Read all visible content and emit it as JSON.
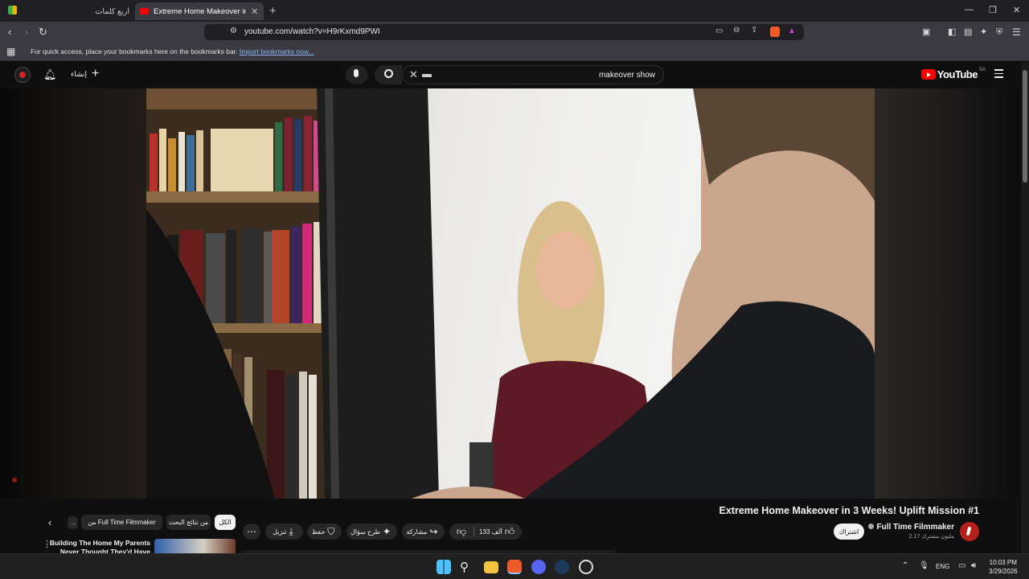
{
  "browser": {
    "tabs": [
      {
        "title": "أربع كلمات",
        "active": false
      },
      {
        "title": "Extreme Home Makeover in 3 Weeks! Uplift Mission #1",
        "active": true
      }
    ],
    "url": "youtube.com/watch?v=H9rKxmd9PWI",
    "bookmarks_bar": {
      "message": "For quick access, place your bookmarks here on the bookmarks bar.",
      "link": "Import bookmarks now..."
    }
  },
  "youtube_header": {
    "logo_text": "YouTube",
    "country_code": "SA",
    "search_value": "makeover show",
    "create_label": "إنشاء"
  },
  "video": {
    "title": "Extreme Home Makeover in 3 Weeks! Uplift Mission #1",
    "channel": {
      "name": "Full Time Filmmaker",
      "subscribers": "2.17 مليون مشترك"
    },
    "subscribe_label": "اشتراك",
    "actions": {
      "likes": "133 ألف",
      "share": "مشاركة",
      "ask": "طرح سؤال",
      "save": "حفظ",
      "download": "تنزيل"
    }
  },
  "chips": {
    "all": "الكل",
    "related": "من نتائج البحث",
    "channel": "من Full Time Filmmaker"
  },
  "recommendation": {
    "title": "Building The Home My Parents Never Thought They'd Have"
  },
  "taskbar": {
    "language": "ENG",
    "time": "10:03 PM",
    "date": "3/29/2026"
  },
  "colors": {
    "youtube_red": "#ff0000",
    "chrome_dark": "#1f1f24",
    "chrome_toolbar": "#3a3a40",
    "page_bg": "#0f0f0f"
  }
}
